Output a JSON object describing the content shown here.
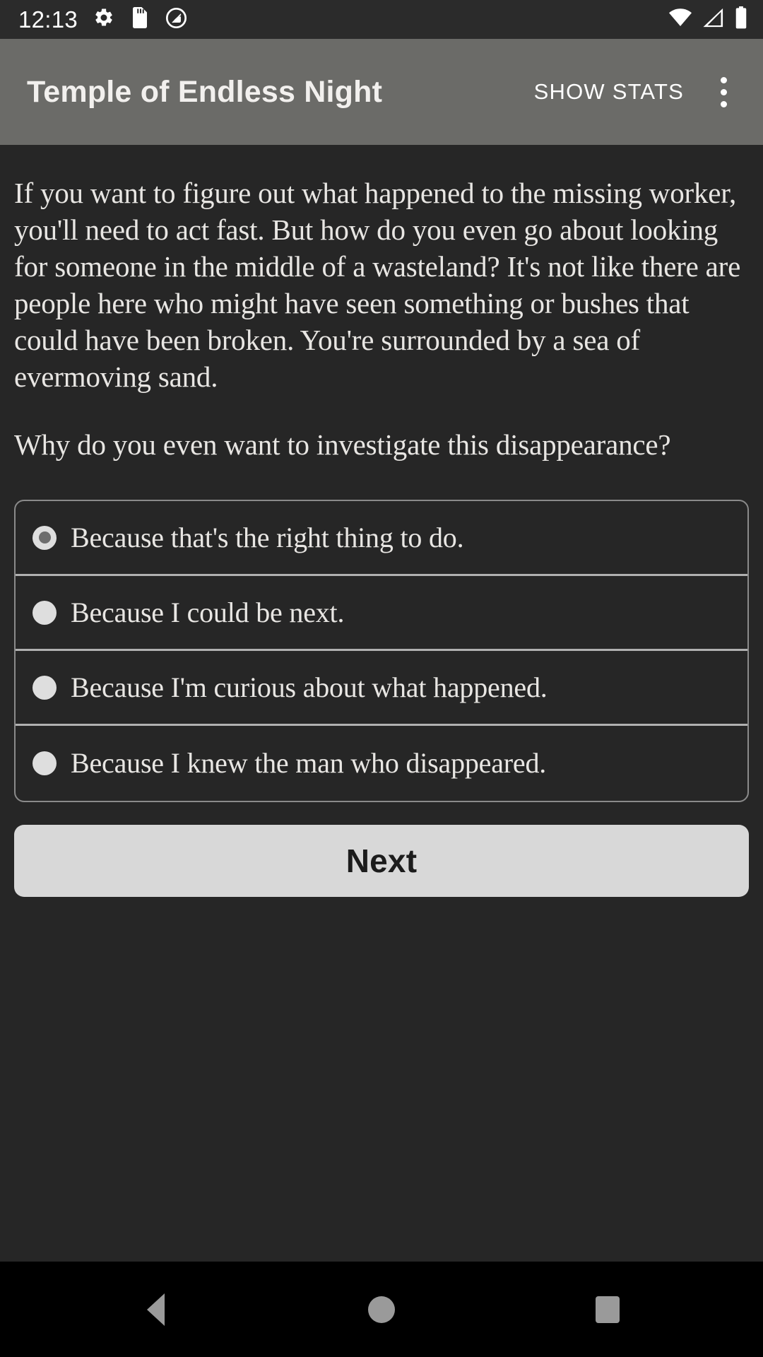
{
  "status_bar": {
    "clock": "12:13",
    "left_icons": [
      "settings-gear-icon",
      "sd-card-icon",
      "do-not-disturb-icon"
    ],
    "right_icons": [
      "wifi-icon",
      "cellular-signal-icon",
      "battery-icon"
    ]
  },
  "app_bar": {
    "title": "Temple of Endless Night",
    "show_stats_label": "SHOW STATS",
    "overflow_icon": "more-vert-icon",
    "background_color": "#6b6b68"
  },
  "story": {
    "paragraphs": [
      "If you want to figure out what happened to the missing worker, you'll need to act fast. But how do you even go about looking for someone in the middle of a wasteland? It's not like there are people here who might have seen something or bushes that could have been broken. You're surrounded by a sea of evermoving sand.",
      "Why do you even want to investigate this disappearance?"
    ]
  },
  "options": [
    {
      "label": "Because that's the right thing to do.",
      "selected": true
    },
    {
      "label": "Because I could be next.",
      "selected": false
    },
    {
      "label": "Because I'm curious about what happened.",
      "selected": false
    },
    {
      "label": "Because I knew the man who disappeared.",
      "selected": false
    }
  ],
  "next_button": {
    "label": "Next",
    "background_color": "#d8d8d8",
    "text_color": "#1c1c1c"
  },
  "nav_bar": {
    "back_label": "Back",
    "home_label": "Home",
    "recents_label": "Recents"
  },
  "theme": {
    "content_background": "#262626",
    "text_color": "#e8e6e3",
    "divider_color": "#b0b0b0",
    "radio_color": "#dedede"
  }
}
